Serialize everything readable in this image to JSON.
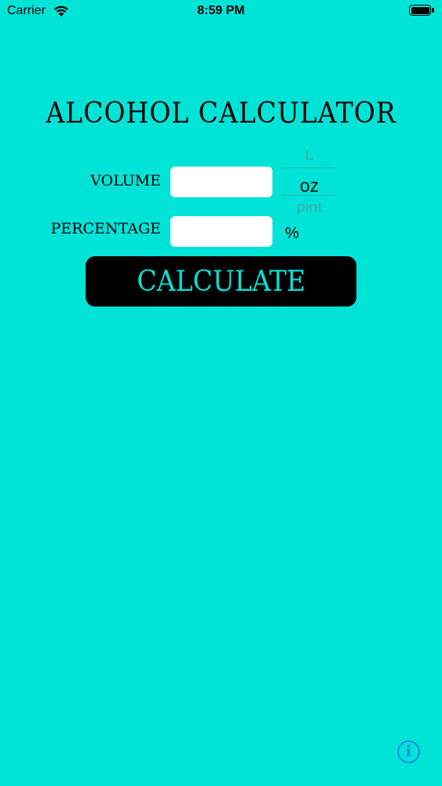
{
  "status_bar": {
    "carrier": "Carrier",
    "time": "8:59 PM",
    "wifi_icon": "wifi-icon",
    "battery_icon": "battery-icon"
  },
  "title": "ALCOHOL CALCULATOR",
  "form": {
    "volume_label": "VOLUME",
    "volume_value": "",
    "percentage_label": "PERCENTAGE",
    "percentage_value": "",
    "percent_symbol": "%",
    "unit_picker": {
      "options": [
        "L",
        "oz",
        "pint"
      ],
      "selected": "oz"
    }
  },
  "calculate_label": "CALCULATE",
  "info_icon": {
    "name": "info-icon",
    "glyph": "i"
  },
  "colors": {
    "background": "#00E4D8",
    "button_bg": "#000000",
    "button_text": "#00E4D8",
    "info_accent": "#1E88E5"
  }
}
